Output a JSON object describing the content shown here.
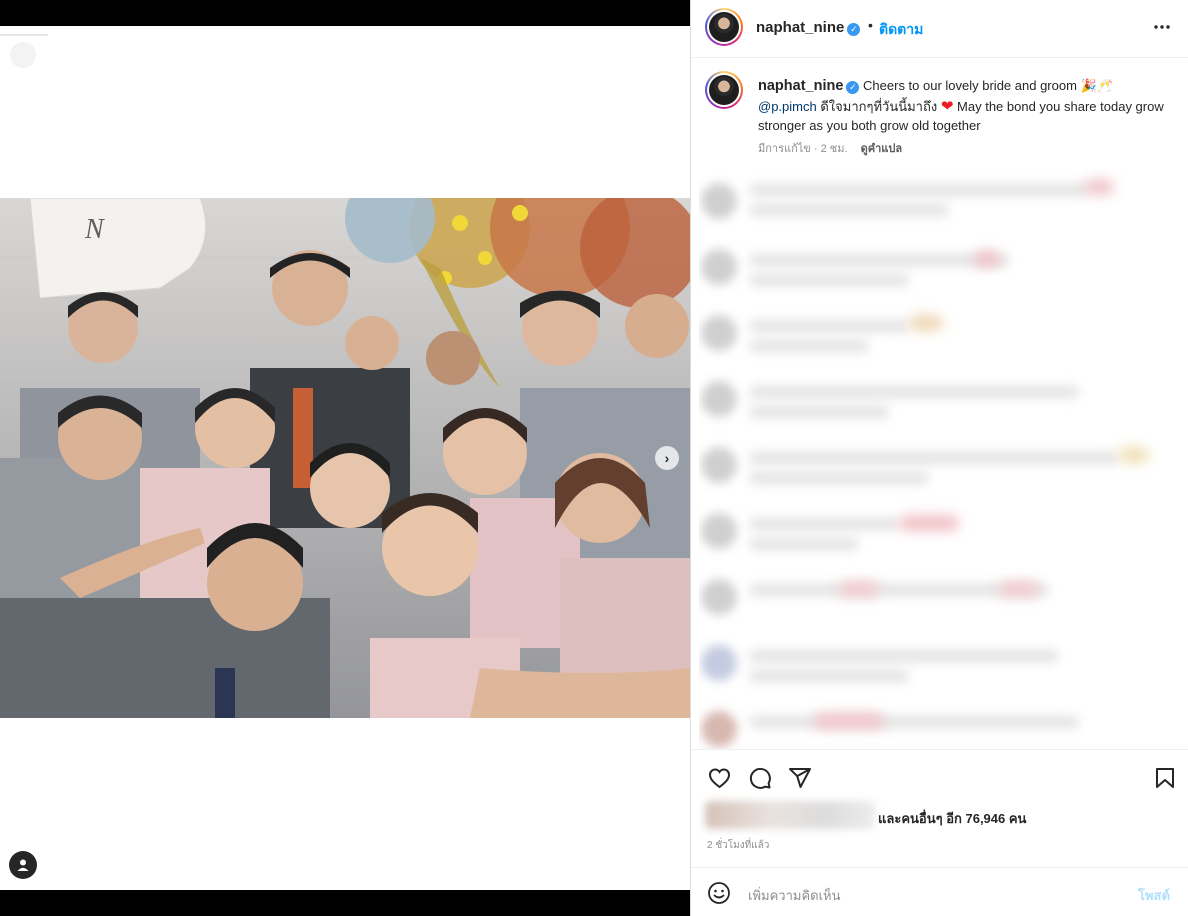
{
  "post": {
    "image_alt": "Group selfie of wedding party",
    "next_icon": "chevron-right-icon",
    "tag_icon": "user-icon"
  },
  "header": {
    "username": "naphat_nine",
    "verified_icon": "verified-badge-icon",
    "separator": "•",
    "follow_label": "ติดตาม",
    "more_icon": "more-horizontal-icon"
  },
  "caption": {
    "username": "naphat_nine",
    "text_part1": "Cheers to our lovely bride and groom 🎉🥂",
    "mention": "@p.pimch",
    "text_part2": "ดีใจมากๆที่วันนี้มาถึง",
    "heart": "❤",
    "text_part3": "May the bond you share today grow stronger as you both grow old together",
    "edited_meta": "มีการแก้ไข · 2 ชม.",
    "translate_label": "ดูคำแปล"
  },
  "actions": {
    "like_icon": "heart-icon",
    "comment_icon": "comment-icon",
    "share_icon": "send-icon",
    "save_icon": "bookmark-icon",
    "likes_text": "และคนอื่นๆ อีก 76,946 คน",
    "time_text": "2 ชั่วโมงที่แล้ว"
  },
  "comment_bar": {
    "emoji_icon": "smiley-icon",
    "placeholder": "เพิ่มความคิดเห็น",
    "post_label": "โพสต์"
  },
  "colors": {
    "accent": "#0095f6",
    "verified": "#3897f0",
    "post_disabled": "#b2dffc",
    "heart": "#ed1c24"
  }
}
